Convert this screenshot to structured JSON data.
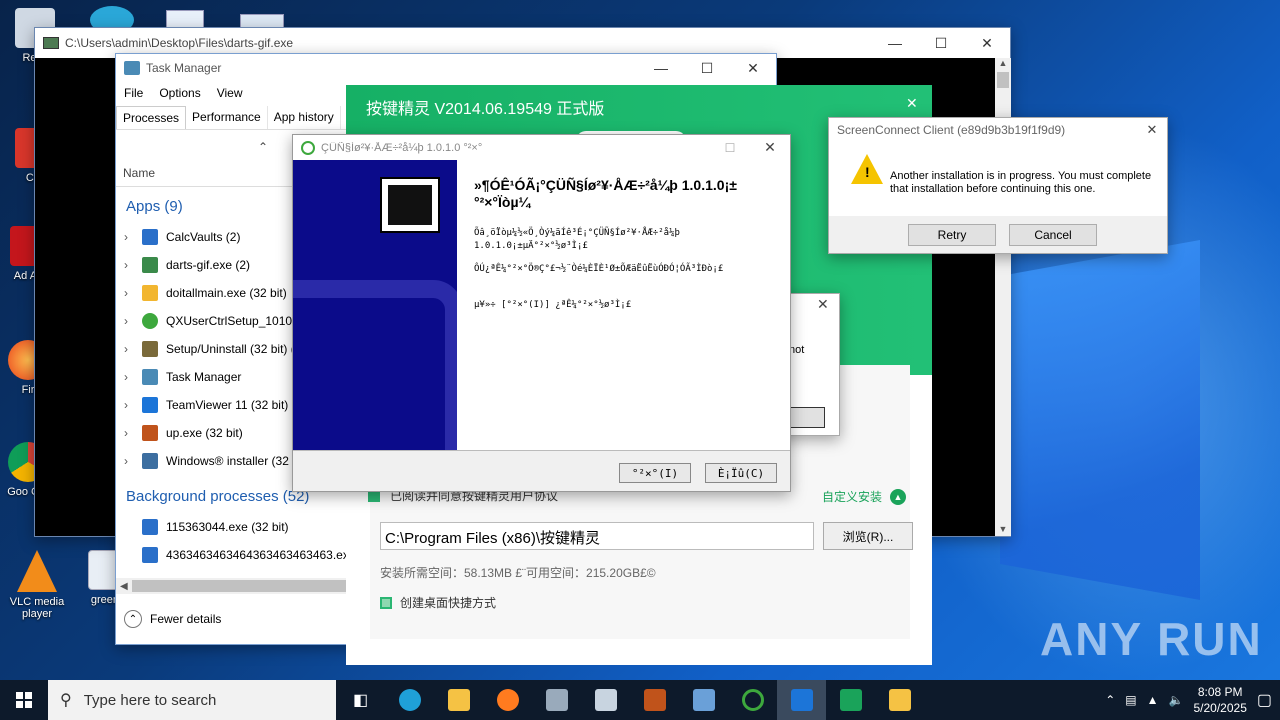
{
  "desktop": {
    "icons": [
      {
        "label": "Recy"
      },
      {
        "label": "CCl"
      },
      {
        "label": "Ad Acr"
      },
      {
        "label": "Fir"
      },
      {
        "label": "Goo Chr"
      },
      {
        "label": "VLC media player"
      },
      {
        "label": "greenp"
      }
    ],
    "watermark": "ANY RUN"
  },
  "console_window": {
    "title": "C:\\Users\\admin\\Desktop\\Files\\darts-gif.exe"
  },
  "task_manager": {
    "title": "Task Manager",
    "menu": [
      "File",
      "Options",
      "View"
    ],
    "tabs": [
      "Processes",
      "Performance",
      "App history",
      "St"
    ],
    "column_name": "Name",
    "apps_header": "Apps (9)",
    "apps": [
      {
        "name": "CalcVaults (2)",
        "color": "#2a6fc9"
      },
      {
        "name": "darts-gif.exe (2)",
        "color": "#3a8a4a"
      },
      {
        "name": "doitallmain.exe (32 bit)",
        "color": "#f2b630"
      },
      {
        "name": "QXUserCtrlSetup_1010.e",
        "color": "#3da83d"
      },
      {
        "name": "Setup/Uninstall (32 bit) (",
        "color": "#7a6a3a"
      },
      {
        "name": "Task Manager",
        "color": "#4a8ab5"
      },
      {
        "name": "TeamViewer 11 (32 bit) (",
        "color": "#1c75d8"
      },
      {
        "name": "up.exe (32 bit)",
        "color": "#c0531b"
      },
      {
        "name": "Windows® installer (32",
        "color": "#3c6ea0"
      }
    ],
    "background_header": "Background processes (52)",
    "background": [
      {
        "name": "115363044.exe (32 bit)"
      },
      {
        "name": "4363463463464363463463463.exe (3"
      }
    ],
    "fewer_details": "Fewer details"
  },
  "green_installer": {
    "title": "按键精灵 V2014.06.19549 正式版",
    "agreement_text": "已阅读并同意按键精灵用户协议",
    "custom_install": "自定义安装",
    "path_value": "C:\\Program Files (x86)\\按键精灵",
    "browse_label": "浏览(R)...",
    "space_text": "安装所需空间：58.13MB  £¨可用空间：215.20GB£©",
    "shortcut_label": "创建桌面快捷方式"
  },
  "hidden_dialog": {
    "partial_text": "not"
  },
  "screenconnect": {
    "title": "ScreenConnect Client (e89d9b3b19f1f9d9)",
    "message": "Another installation is in progress. You must complete that installation before continuing this one.",
    "retry": "Retry",
    "cancel": "Cancel"
  },
  "setup_dialog": {
    "title": "ÇÜÑ§Íø²¥·ÅÆ÷²å¼þ 1.0.1.0 °²×°",
    "heading": "»¶Ó­Ê¹ÓÃ¡°ÇÜÑ§Íø²¥·ÅÆ÷²å¼þ 1.0.1.0¡±°²×°Ïòµ¼",
    "para1": "Õâ¸öÏòµ¼½«Ö¸Òý¼ãÍê³É¡°ÇÜÑ§Íø²¥·ÅÆ÷²å¼þ 1.0.1.0¡±µÄ°²×°½ø³Ì¡£",
    "para2": "ÔÚ¿ªÊ¼°²×°Ö®Ç°£¬½¨Òé¼ÈÏÈ¹Ø±ÕÆäËûËùÓÐÓ¦ÓÃ³ÌÐò¡£",
    "para3": "µ¥»÷ [°²×°(I)] ¿ªÊ¼°²×°½ø³Ì¡£",
    "install_btn": "°²×°(I)",
    "cancel_btn": "È¡Ïû(C)"
  },
  "taskbar": {
    "search_placeholder": "Type here to search",
    "time": "8:08 PM",
    "date": "5/20/2025"
  }
}
